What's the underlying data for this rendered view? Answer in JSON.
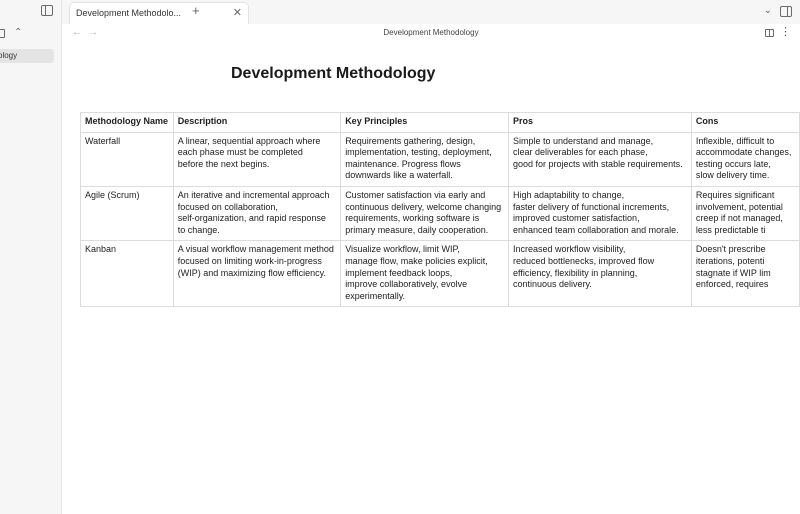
{
  "sidebar": {
    "file_label": "ology"
  },
  "tabbar": {
    "tab_title": "Development Methodolo...",
    "close_glyph": "✕",
    "new_tab_glyph": "+",
    "tab_list_glyph": "⌄"
  },
  "view_header": {
    "back_glyph": "←",
    "forward_glyph": "→",
    "title": "Development Methodology",
    "more_glyph": "⋮"
  },
  "document": {
    "title": "Development Methodology",
    "table": {
      "headers": [
        "Methodology Name",
        "Description",
        "Key Principles",
        "Pros",
        "Cons"
      ],
      "rows": [
        [
          "Waterfall",
          "A linear, sequential approach where\neach phase must be completed\nbefore the next begins.",
          "Requirements gathering, design,\nimplementation, testing, deployment,\nmaintenance. Progress flows\ndownwards like a waterfall.",
          "Simple to understand and manage,\nclear deliverables for each phase,\ngood for projects with stable requirements.",
          "Inflexible, difficult to\naccommodate changes,\ntesting occurs late,\nslow delivery time."
        ],
        [
          "Agile (Scrum)",
          "An iterative and incremental approach\nfocused on collaboration,\nself-organization, and rapid response\nto change.",
          "Customer satisfaction via early and\ncontinuous delivery, welcome changing\nrequirements, working software is\nprimary measure, daily cooperation.",
          "High adaptability to change,\nfaster delivery of functional increments,\nimproved customer satisfaction,\nenhanced team collaboration and morale.",
          "Requires significant\ninvolvement, potential\ncreep if not managed,\nless predictable ti"
        ],
        [
          "Kanban",
          "A visual workflow management method\nfocused on limiting work-in-progress\n(WIP) and maximizing flow efficiency.",
          "Visualize workflow, limit WIP,\nmanage flow, make policies explicit,\nimplement feedback loops,\nimprove collaboratively, evolve\nexperimentally.",
          "Increased workflow visibility,\nreduced bottlenecks, improved flow\nefficiency, flexibility in planning,\ncontinuous delivery.",
          "Doesn't prescribe\niterations, potenti\nstagnate if WIP lim\nenforced, requires"
        ]
      ]
    }
  },
  "icons": {
    "sidebar_toggle": "left-sidebar-icon",
    "right_sidebar_toggle": "right-sidebar-icon",
    "reading_mode": "book-icon"
  }
}
